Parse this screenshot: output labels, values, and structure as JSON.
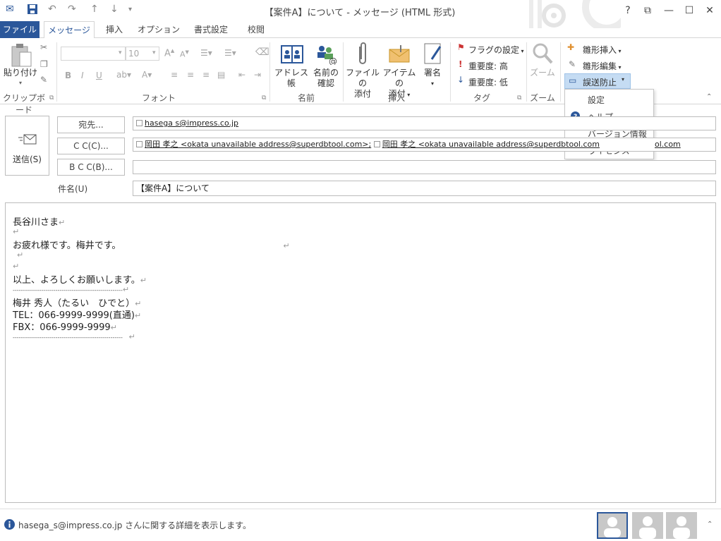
{
  "window": {
    "title": "【案件A】について - メッセージ (HTML 形式)",
    "help": "?",
    "restore": "⧉",
    "minimize": "—",
    "maximize": "☐",
    "close": "✕"
  },
  "tabs": {
    "file": "ファイル",
    "message": "メッセージ",
    "insert": "挿入",
    "options": "オプション",
    "format": "書式設定",
    "review": "校閲"
  },
  "ribbon": {
    "clipboard": {
      "paste": "貼り付け",
      "label": "クリップボード"
    },
    "font": {
      "size": "10",
      "label": "フォント"
    },
    "names": {
      "address_book": "アドレス帳",
      "check_names_1": "名前の",
      "check_names_2": "確認",
      "label": "名前"
    },
    "include": {
      "attach_file_1": "ファイルの",
      "attach_file_2": "添付",
      "attach_item_1": "アイテムの",
      "attach_item_2": "添付",
      "signature": "署名",
      "label": "挿入"
    },
    "tags": {
      "follow_up": "フラグの設定",
      "high_importance": "重要度: 高",
      "low_importance": "重要度: 低",
      "label": "タグ"
    },
    "zoom": {
      "zoom": "ズーム",
      "label": "ズーム"
    },
    "addin": {
      "insert_template": "雛形挿入",
      "edit_template": "雛形編集",
      "misdelivery": "誤送防止"
    }
  },
  "dropdown": {
    "items": [
      "設定",
      "ヘルプ",
      "バージョン情報",
      "ライセンス"
    ]
  },
  "compose": {
    "send": "送信(S)",
    "to_button": "宛先...",
    "cc_button": "C C(C)...",
    "bcc_button": "B C C(B)...",
    "subject_label": "件名(U)",
    "to_value": "hasega s@impress.co.jp",
    "cc_value_1": "岡田 孝之 <okata unavailable address@superdbtool.com>;",
    "cc_value_2": "岡田 孝之 <okata unavailable address@superdbtool.com",
    "cc_value_tail": "ol.com",
    "bcc_value": "",
    "subject_value": "【案件A】について"
  },
  "body": {
    "lines": [
      "長谷川さま",
      "",
      "お疲れ様です。梅井です。",
      "",
      "",
      "以上、よろしくお願いします。",
      "------------------------------------------------------",
      "梅井 秀人（たるい　ひでと）",
      "TEL：066-9999-9999(直通)",
      "FBX：066-9999-9999",
      "------------------------------------------------------ "
    ]
  },
  "status": {
    "text": "hasega_s@impress.co.jp さんに関する詳細を表示します。"
  },
  "colors": {
    "accent": "#2b579a",
    "dropdown_highlight": "#c5dcf3"
  }
}
